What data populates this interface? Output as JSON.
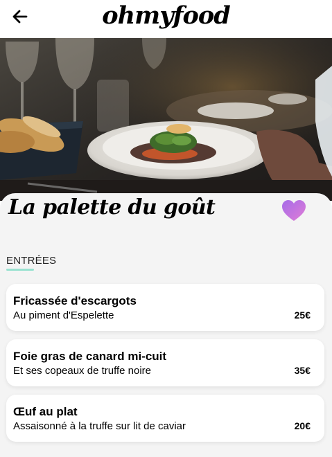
{
  "header": {
    "brand": "ohmyfood",
    "back_icon": "arrow-left-icon"
  },
  "hero": {
    "description_icon": "restaurant-photo"
  },
  "restaurant": {
    "name": "La palette du goût",
    "like_icon": "heart-icon",
    "like_color": "#c774e6"
  },
  "menu": {
    "section_title": "ENTRÉES",
    "accent_color": "#99e2d0",
    "items": [
      {
        "name": "Fricassée d'escargots",
        "description": "Au piment d'Espelette",
        "price": "25€"
      },
      {
        "name": "Foie gras de canard mi-cuit",
        "description": "Et ses copeaux de truffe noire",
        "price": "35€"
      },
      {
        "name": "Œuf au plat",
        "description": "Assaisonné à la truffe sur lit de caviar",
        "price": "20€"
      }
    ]
  }
}
